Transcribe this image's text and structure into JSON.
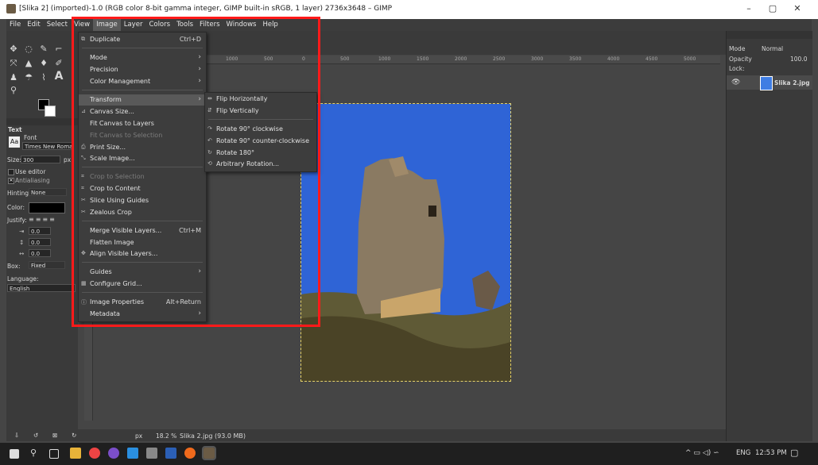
{
  "window": {
    "title": "[Slika 2] (imported)-1.0 (RGB color 8-bit gamma integer, GIMP built-in sRGB, 1 layer) 2736x3648 – GIMP",
    "minimize": "–",
    "maximize": "▢",
    "close": "✕"
  },
  "menubar": {
    "items": [
      "File",
      "Edit",
      "Select",
      "View",
      "Image",
      "Layer",
      "Colors",
      "Tools",
      "Filters",
      "Windows",
      "Help"
    ],
    "active": "Image"
  },
  "image_menu": {
    "duplicate": {
      "label": "Duplicate",
      "shortcut": "Ctrl+D"
    },
    "mode": "Mode",
    "precision": "Precision",
    "color_management": "Color Management",
    "transform": "Transform",
    "canvas_size": "Canvas Size...",
    "fit_canvas_layers": "Fit Canvas to Layers",
    "fit_canvas_selection": "Fit Canvas to Selection",
    "print_size": "Print Size...",
    "scale_image": "Scale Image...",
    "crop_to_selection": "Crop to Selection",
    "crop_to_content": "Crop to Content",
    "slice_using_guides": "Slice Using Guides",
    "zealous_crop": "Zealous Crop",
    "merge_visible": {
      "label": "Merge Visible Layers...",
      "shortcut": "Ctrl+M"
    },
    "flatten": "Flatten Image",
    "align_visible": "Align Visible Layers...",
    "guides": "Guides",
    "configure_grid": "Configure Grid...",
    "image_properties": {
      "label": "Image Properties",
      "shortcut": "Alt+Return"
    },
    "metadata": "Metadata"
  },
  "transform_submenu": {
    "flip_h": "Flip Horizontally",
    "flip_v": "Flip Vertically",
    "rot90cw": "Rotate 90° clockwise",
    "rot90ccw": "Rotate 90° counter-clockwise",
    "rot180": "Rotate 180°",
    "arbitrary": "Arbitrary Rotation..."
  },
  "tool_options": {
    "title": "Text",
    "font_label": "Font",
    "font_value": "Times New Roman",
    "size_label": "Size:",
    "size_value": "300",
    "size_unit": "px",
    "use_editor": "Use editor",
    "antialiasing": "Antialiasing",
    "hinting_label": "Hinting:",
    "hinting_value": "None",
    "color_label": "Color:",
    "justify_label": "Justify:",
    "indent_value": "0.0",
    "line_spacing_value": "0.0",
    "letter_spacing_value": "0.0",
    "box_label": "Box:",
    "box_value": "Fixed",
    "language_label": "Language:",
    "language_value": "English"
  },
  "ruler_ticks": [
    "1000",
    "500",
    "0",
    "500",
    "1000",
    "1500",
    "2000",
    "2500",
    "3000",
    "3500",
    "4000",
    "4500",
    "5000"
  ],
  "status": {
    "unit": "px",
    "zoom": "18.2 %",
    "file_info": "Slika 2.jpg (93.0 MB)"
  },
  "layers": {
    "mode_label": "Mode",
    "mode_value": "Normal",
    "opacity_label": "Opacity",
    "opacity_value": "100.0",
    "lock_label": "Lock:",
    "layer_name": "Slika 2.jpg"
  },
  "taskbar": {
    "language": "ENG",
    "time": "12:53 PM"
  }
}
